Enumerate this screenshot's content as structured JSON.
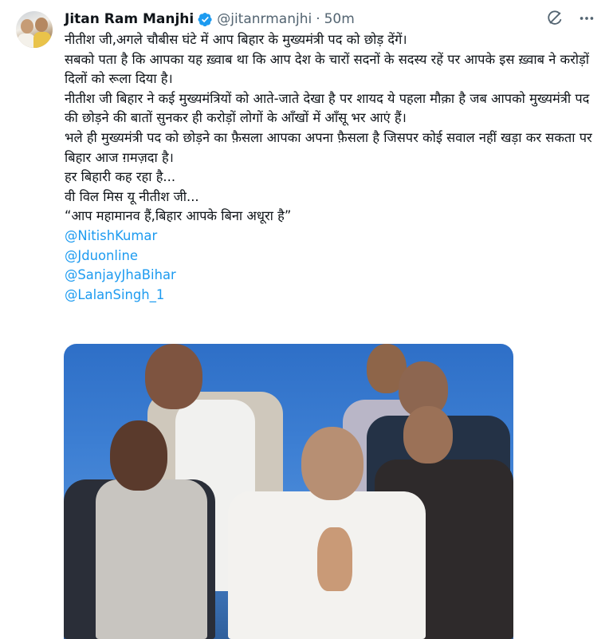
{
  "tweet": {
    "author_name": "Jitan Ram Manjhi",
    "handle": "@jitanrmanjhi",
    "separator": "·",
    "time": "50m",
    "lines": [
      "नीतीश जी,अगले चौबीस घंटे में आप बिहार के मुख्यमंत्री पद को छोड़ देंगें।",
      "सबको पता है कि आपका यह ख़्वाब था कि आप देश के चारों सदनों के सदस्य रहें पर आपके इस ख़्वाब ने करोड़ों दिलों को रूला दिया है।",
      "नीतीश जी बिहार ने कई मुख्यमंत्रियों को आते-जाते देखा है पर शायद ये पहला मौक़ा है जब आपको मुख्यमंत्री पद की छोड़ने की बातों सुनकर ही करोड़ों लोगों के आँखों में आँसू भर आएं हैं।",
      "भले ही मुख्यमंत्री पद को छोड़ने का फ़ैसला आपका अपना फ़ैसला है जिसपर कोई सवाल नहीं खड़ा कर सकता पर बिहार आज ग़मज़दा है।",
      "हर बिहारी कह रहा है...",
      "वी विल मिस यू नीतीश जी...",
      "“आप महामानव हैं,बिहार आपके बिना अधूरा है”"
    ],
    "mentions": [
      "@NitishKumar",
      "@Jduonline",
      "@SanjayJhaBihar",
      "@LalanSingh_1"
    ]
  },
  "icons": {
    "verified": "verified-badge-icon",
    "grok": "grok-icon",
    "more": "more-options-icon"
  },
  "colors": {
    "link": "#1d9bf0",
    "verified": "#1d9bf0",
    "muted": "#536471",
    "text": "#0f1419"
  }
}
